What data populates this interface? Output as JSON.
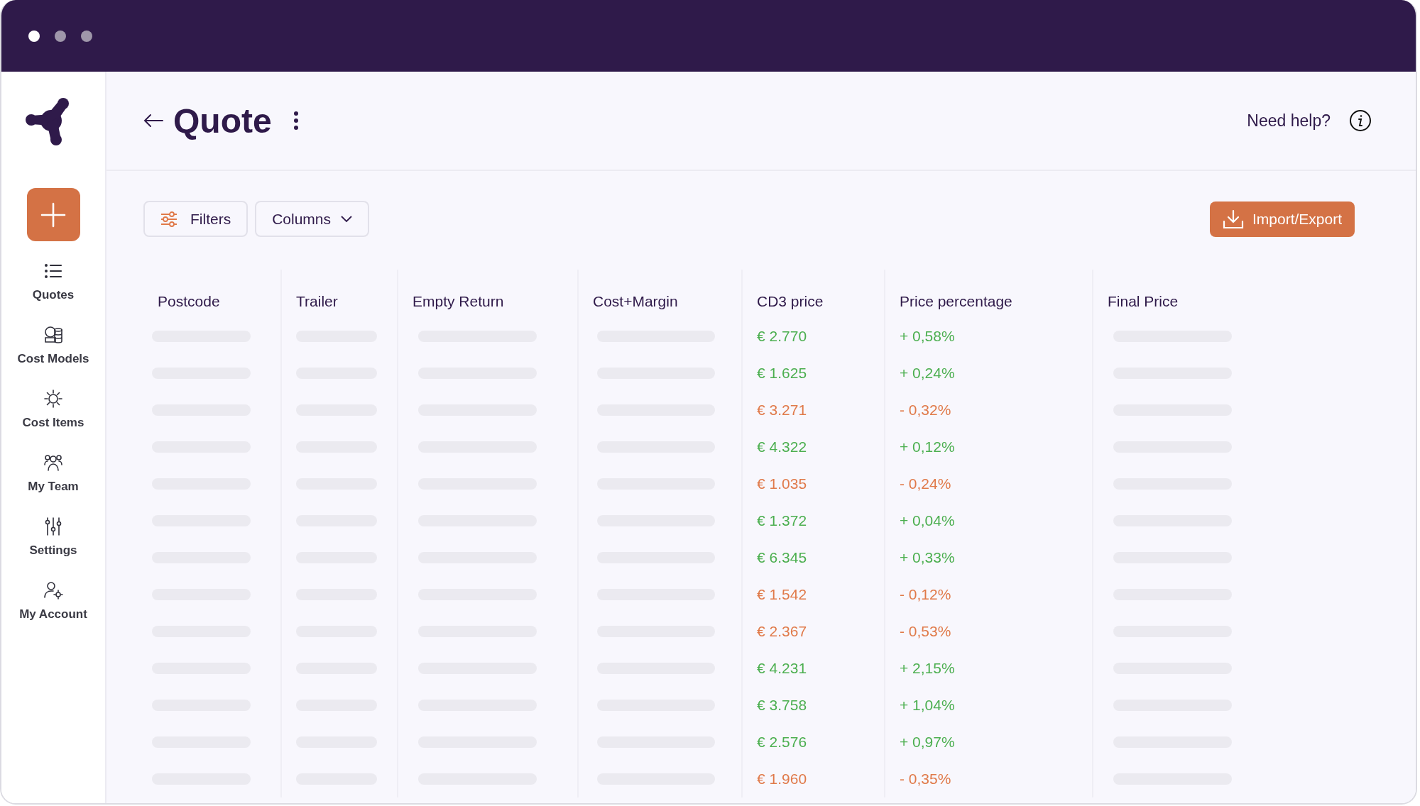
{
  "page": {
    "title": "Quote",
    "help": "Need help?"
  },
  "sidebar": {
    "items": [
      {
        "label": "Quotes"
      },
      {
        "label": "Cost Models"
      },
      {
        "label": "Cost Items"
      },
      {
        "label": "My Team"
      },
      {
        "label": "Settings"
      },
      {
        "label": "My Account"
      }
    ]
  },
  "toolbar": {
    "filters": "Filters",
    "columns": "Columns",
    "import_export": "Import/Export"
  },
  "table": {
    "columns": [
      "Postcode",
      "Trailer",
      "Empty Return",
      "Cost+Margin",
      "CD3 price",
      "Price percentage",
      "Final Price"
    ],
    "rows": [
      {
        "loading": true,
        "cd3_price": "€ 2.770",
        "price_percentage": "+ 0,58%",
        "color": "#4caf50"
      },
      {
        "loading": true,
        "cd3_price": "€ 1.625",
        "price_percentage": "+ 0,24%",
        "color": "#4caf50"
      },
      {
        "loading": true,
        "cd3_price": "€ 3.271",
        "price_percentage": "- 0,32%",
        "color": "#e07a4a"
      },
      {
        "loading": true,
        "cd3_price": "€ 4.322",
        "price_percentage": "+ 0,12%",
        "color": "#4caf50"
      },
      {
        "loading": true,
        "cd3_price": "€ 1.035",
        "price_percentage": "- 0,24%",
        "color": "#e07a4a"
      },
      {
        "loading": true,
        "cd3_price": "€ 1.372",
        "price_percentage": "+ 0,04%",
        "color": "#4caf50"
      },
      {
        "loading": true,
        "cd3_price": "€ 6.345",
        "price_percentage": "+ 0,33%",
        "color": "#4caf50"
      },
      {
        "loading": true,
        "cd3_price": "€ 1.542",
        "price_percentage": "- 0,12%",
        "color": "#e07a4a"
      },
      {
        "loading": true,
        "cd3_price": "€ 2.367",
        "price_percentage": "- 0,53%",
        "color": "#e07a4a"
      },
      {
        "loading": true,
        "cd3_price": "€ 4.231",
        "price_percentage": "+ 2,15%",
        "color": "#4caf50"
      },
      {
        "loading": true,
        "cd3_price": "€ 3.758",
        "price_percentage": "+ 1,04%",
        "color": "#4caf50"
      },
      {
        "loading": true,
        "cd3_price": "€ 2.576",
        "price_percentage": "+ 0,97%",
        "color": "#4caf50"
      },
      {
        "loading": true,
        "cd3_price": "€ 1.960",
        "price_percentage": "- 0,35%",
        "color": "#e07a4a"
      }
    ]
  }
}
